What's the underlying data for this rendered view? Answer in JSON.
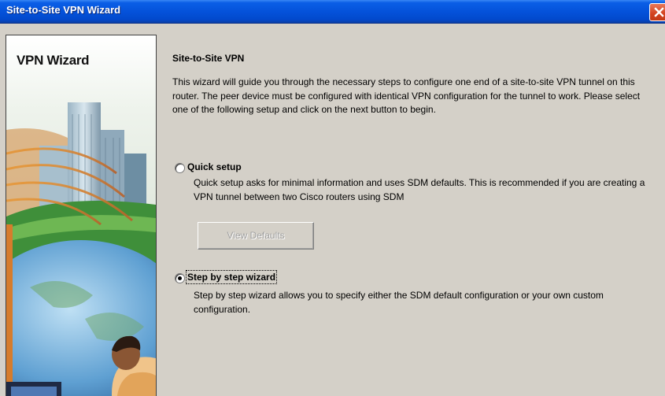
{
  "window": {
    "title": "Site-to-Site VPN Wizard"
  },
  "side_panel": {
    "title": "VPN Wizard"
  },
  "main": {
    "heading": "Site-to-Site VPN",
    "intro": "This wizard will guide you through the necessary steps to configure one end of a site-to-site VPN tunnel on this router. The peer device must be configured with identical VPN configuration for the tunnel to work. Please select one of the following setup and click on the next button to begin.",
    "options": [
      {
        "label": "Quick setup",
        "description": "Quick setup asks for minimal information and uses SDM defaults. This is recommended if you are creating a VPN tunnel between two Cisco routers using SDM",
        "selected": false
      },
      {
        "label": "Step by step wizard",
        "description": "Step by step wizard allows you to specify either the SDM default configuration or your own custom configuration.",
        "selected": true
      }
    ],
    "view_defaults_label": "View Defaults"
  },
  "icons": [
    "close-icon",
    "radio-unchecked",
    "radio-checked"
  ],
  "colors": {
    "titlebar": "#0451d9",
    "close_button": "#d2421f",
    "dialog_background": "#d4d0c8",
    "disabled_text": "#a0a0a0"
  }
}
